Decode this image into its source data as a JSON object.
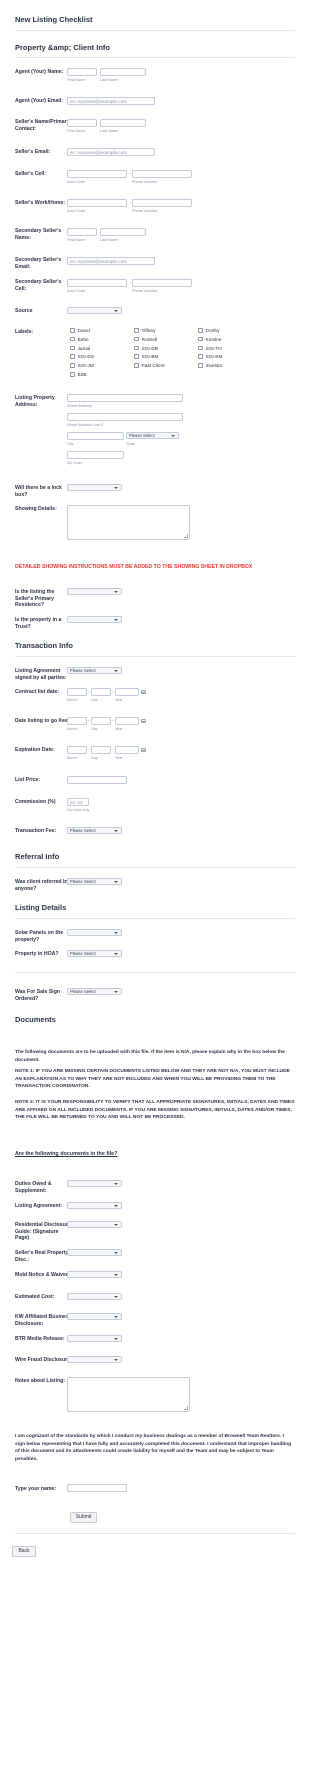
{
  "form": {
    "title": "New Listing Checklist",
    "sections": {
      "property_client": "Property &amp; Client Info",
      "transaction": "Transaction Info",
      "referral": "Referral Info",
      "listing": "Listing Details",
      "documents": "Documents"
    }
  },
  "sublabels": {
    "first_name": "First Name",
    "last_name": "Last Name",
    "area_code": "Area Code",
    "phone_number": "Phone Number",
    "street_address": "Street Address",
    "street_address_2": "Street Address Line 2",
    "city": "City",
    "state": "State",
    "zip": "Zip Code",
    "month": "Month",
    "day": "Day",
    "year": "Year",
    "our_side_only": "Our side only"
  },
  "placeholders": {
    "email": "ex: myname@example.com",
    "commission": "ex: 23"
  },
  "separators": {
    "phone": "-",
    "date": "-"
  },
  "select_default": "Please Select",
  "fields": {
    "agent_name": "Agent (Your) Name:",
    "agent_email": "Agent (Your) Email:",
    "seller_name": "Seller's Name/Primary Contact:",
    "seller_email": "Seller's Email:",
    "seller_cell": "Seller's Cell:",
    "seller_work": "Seller's Work/Home:",
    "secondary_name": "Secondary Seller's Name:",
    "secondary_email": "Secondary Seller's Email:",
    "secondary_cell": "Secondary Seller's Cell:",
    "source": "Source",
    "labels": "Labels:",
    "listing_address": "Listing Property Address:",
    "lock_box": "Will there be a lock box?",
    "showing_details": "Showing Details:",
    "primary_residence": "Is the listing the Seller's Primary Residence?",
    "trust": "Is the property in a Trust?",
    "agreement_signed": "Listing Agreement signed by all parties:",
    "contract_date": "Contract list date:",
    "go_live": "Date listing to go live:",
    "expiration": "Expiration Date:",
    "list_price": "List Price:",
    "commission": "Commission (%)",
    "transaction_fee": "Transaction Fee:",
    "referred": "Was client referred by anyone?",
    "solar": "Solar Panels on the property?",
    "hoa": "Property in HOA?",
    "sign": "Was For Sale Sign Ordered?",
    "duties_owed": "Duties Owed & Supplement:",
    "listing_agreement": "Listing Agreement:",
    "residential_disclosure": "Residential Disclosure Guide: (Signature Page)",
    "real_property_disc": "Seller's Real Property Disc.:",
    "mold": "Mold Notice & Waiver:",
    "estimated_cost": "Estimated Cost:",
    "kw_affiliated": "KW Affiliated Business Disclosure:",
    "btr_media": "BTR Media Release:",
    "wire_fraud": "Wire Fraud Disclosure:",
    "notes": "Notes about Listing:",
    "type_name": "Type your name:"
  },
  "labels_options": [
    "David",
    "Tiffany",
    "Dorthy",
    "Bebe",
    "Russell",
    "Kristine",
    "Jamal",
    "SOI-DB",
    "SOI-TH",
    "SOI-DS",
    "SOI-BM",
    "SOI-KM",
    "SOI-JM",
    "Past Client",
    "Investor",
    "B2B"
  ],
  "warning": "DETAILED SHOWING INSTRUCTIONS MUST BE ADDED TO THE SHOWING SHEET IN DROPBOX",
  "documents": {
    "intro": "The following documents are to be uploaded with this file.  If the item is N/A, please explain why in the box below the document.",
    "note1": "NOTE 1: IF YOU ARE MISSING CERTAIN DOCUMENTS LISTED BELOW AND THEY ARE NOT N/A, YOU MUST INCLUDE AN EXPLANATION AS TO WHY THEY ARE NOT INCLUDED AND WHEN YOU WILL BE PROVIDING THEM TO THE TRANSACTION COORDINATOR.",
    "note2": "NOTE 2: IT IS YOUR RESPONSIBILITY TO VERIFY THAT ALL APPROPRIATE SIGNATURES, INITIALS, DATES AND TIMES ARE AFFIXED ON ALL INCLUDED DOCUMENTS.  IF YOU ARE MISSING SIGNATURES, INITIALS, DATES AND/OR TIMES, THE FILE WILL BE RETURNED TO YOU AND WILL NOT BE PROCESSED.",
    "question": "Are the following documents in the file?",
    "acknowledgement": "I am cognizant of the standards by which I conduct my business dealings as a member of Brownell Team Realtors.  I sign below representing that I have fully and accurately completed this document.  I understand that improper handling of this document and its attachments could create liability for myself and the Team and may be subject to Team penalties."
  },
  "buttons": {
    "submit": "Submit",
    "back": "Back"
  },
  "icons": {
    "calendar": "calendar-icon",
    "dropdown": "chevron-down-icon"
  },
  "colors": {
    "warning": "#e8372f",
    "text": "#2c3345",
    "border": "#c3cad8"
  }
}
